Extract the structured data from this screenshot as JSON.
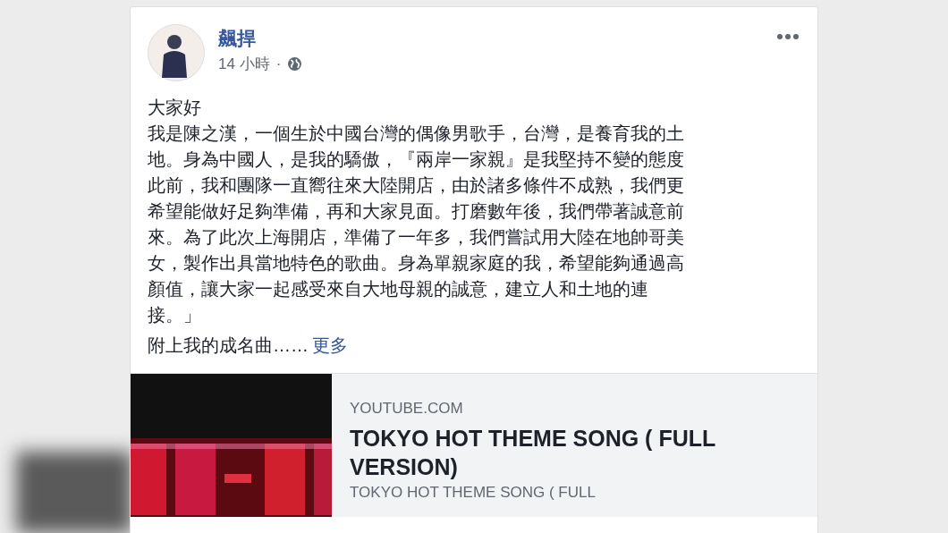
{
  "post": {
    "author": "飆捍",
    "time": "14 小時",
    "separator": "·",
    "body_lines": [
      "大家好",
      "我是陳之漢，一個生於中國台灣的偶像男歌手，台灣，是養育我的土",
      "地。身為中國人，是我的驕傲，『兩岸一家親』是我堅持不變的態度",
      "此前，我和團隊一直嚮往來大陸開店，由於諸多條件不成熟，我們更",
      "希望能做好足夠準備，再和大家見面。打磨數年後，我們帶著誠意前",
      "來。為了此次上海開店，準備了一年多，我們嘗試用大陸在地帥哥美",
      "女，製作出具當地特色的歌曲。身為單親家庭的我，希望能夠通過高",
      "顏值，讓大家一起感受來自大地母親的誠意，建立人和土地的連",
      "接。」"
    ],
    "teaser": "附上我的成名曲……",
    "more_link": "更多",
    "link_preview": {
      "kind": "picture",
      "domain": "YOUTUBE.COM",
      "title": "TOKYO HOT THEME SONG ( FULL VERSION)",
      "description": "TOKYO HOT THEME SONG ( FULL"
    }
  }
}
